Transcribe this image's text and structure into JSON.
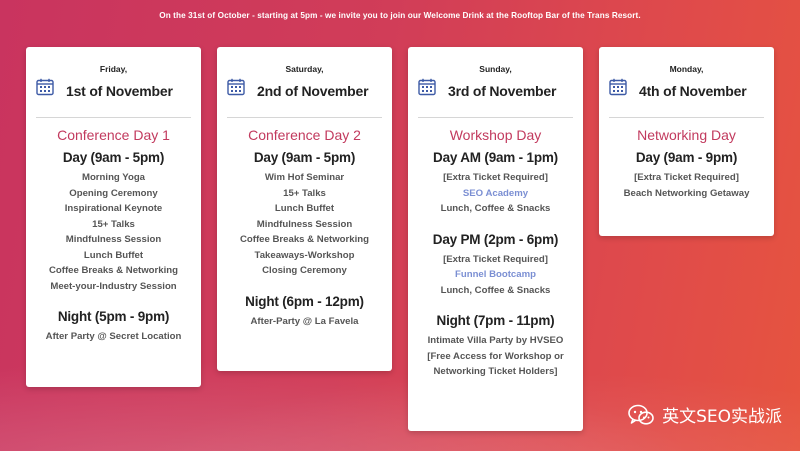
{
  "banner": "On the 31st of October - starting at 5pm - we invite you to join our Welcome Drink at the Rooftop Bar of the Trans Resort.",
  "watermark": "英文SEO实战派",
  "colors": {
    "accent": "#c23a5e",
    "link": "#7b8fd3",
    "text": "#555555"
  },
  "cards": [
    {
      "weekday": "Friday,",
      "date": "1st of November",
      "title": "Conference Day 1",
      "sections": [
        {
          "title": "Day (9am - 5pm)",
          "items": [
            "Morning Yoga",
            "Opening Ceremony",
            "Inspirational Keynote",
            "15+ Talks",
            "Mindfulness Session",
            "Lunch Buffet",
            "Coffee Breaks & Networking",
            "Meet-your-Industry Session"
          ]
        },
        {
          "title": "Night (5pm - 9pm)",
          "items": [
            "After Party @ Secret Location"
          ]
        }
      ]
    },
    {
      "weekday": "Saturday,",
      "date": "2nd of November",
      "title": "Conference Day 2",
      "sections": [
        {
          "title": "Day (9am - 5pm)",
          "items": [
            "Wim Hof Seminar",
            "15+ Talks",
            "Lunch Buffet",
            "Mindfulness Session",
            "Coffee Breaks & Networking",
            "Takeaways-Workshop",
            "Closing Ceremony"
          ]
        },
        {
          "title": "Night (6pm - 12pm)",
          "items": [
            "After-Party @ La Favela"
          ]
        }
      ]
    },
    {
      "weekday": "Sunday,",
      "date": "3rd of November",
      "title": "Workshop Day",
      "sections": [
        {
          "title": "Day AM (9am - 1pm)",
          "items": [
            "[Extra Ticket Required]",
            "SEO Academy",
            "Lunch, Coffee & Snacks"
          ]
        },
        {
          "title": "Day PM (2pm - 6pm)",
          "items": [
            "[Extra Ticket Required]",
            "Funnel Bootcamp",
            "Lunch, Coffee & Snacks"
          ]
        },
        {
          "title": "Night (7pm - 11pm)",
          "items": [
            "Intimate Villa Party by HVSEO",
            "[Free Access for Workshop or",
            "Networking Ticket Holders]"
          ]
        }
      ]
    },
    {
      "weekday": "Monday,",
      "date": "4th of November",
      "title": "Networking Day",
      "sections": [
        {
          "title": "Day (9am - 9pm)",
          "items": [
            "[Extra Ticket Required]",
            "Beach Networking Getaway"
          ]
        }
      ]
    }
  ]
}
